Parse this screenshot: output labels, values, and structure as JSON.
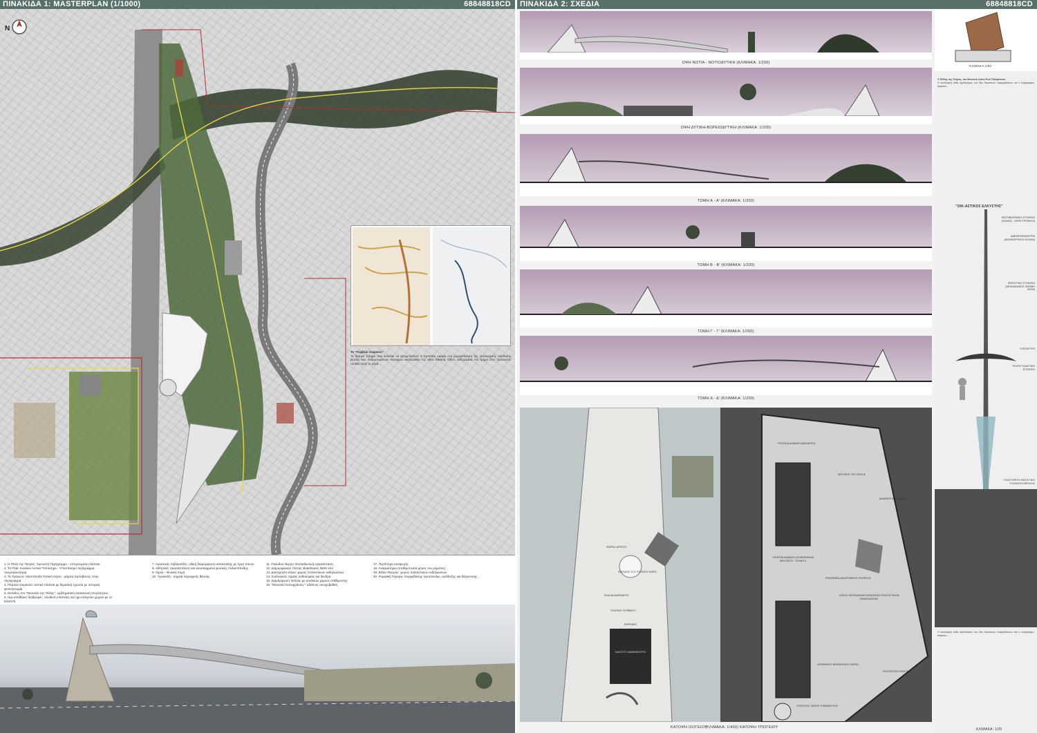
{
  "sheet1": {
    "title": "ΠΙΝΑΚΙΔΑ 1: MASTERPLAN (1/1000)",
    "code": "68848818CD",
    "north": "N",
    "desc_heading": "Το \"Περβόλι Ουρανού\"",
    "desc_text": "Το βασικό ζήτημα που καλείται να αντιμετωπίσει η πρόταση αφορά στη μορφοποίηση της λειτουργικής σύνδεσης μεταξύ των απομονωμένων περιοχών εκατέρωθεν της οδού Εθνικής Οδού, ενδεχόμενα στο τμήμα που πρόσκειται τοπικά προς το ρέμα...",
    "legend": [
      "1. Η Πύλη της Πετρας: Χρεωστή Περίγραμμο - υπογειωμένη πλατεία",
      "2. Το Πλάι: Κυκλικό Αστικό Τοπόσημο - Υποστάσιμο περίγραμμο, Ανεμογεννήτρια",
      "3. Το Τρίγωνο: Ηλιοτόποδο Τοπικό κτίριο - ράμπα πρόσβασης στην περίγραμμα",
      "4. Πλατεία Ουρανού: αστική πλατεία με θεματική έχουσα με ιστορική φυσιογνωμία",
      "5. Είσοδος στο \"Μουσείο της Πόλης\": εμβληματική κατασκευή στεγάστρου",
      "6. Ημι-υπαίθριες διαδρομές: σύνδεση πλατείας και ημι-υπόγειου χώρου με το ΕΘΙΑΓΕ",
      "7. Αγαστικός Λαβύρινθος: οδική διαμόρφωση καταστάλης με έργα πόνου",
      "8. Αθλητικές εγκαταστάσεις και ανασκαμμένα φυσικής πολυεπίπεδης",
      "9. Λίμνη - Φυσική πηγή",
      "10. Υγειοειδή - σημεία περιοχικής θέασης",
      "11. Πολυδύο Νερού: Εκπαιδευτική εγκατάσταση",
      "12. Διαμορφώσεις πίστας skateboard, BMX κλπ",
      "13. Διατηρητέο κτίριο: χώρος πολιτιστικών εκδηλώσεων",
      "14. Συλλογικός τομέας ανθοκομίας και δενδρα",
      "15. Διαμόρφωση πισίνας με κυκλικών χώρων στάθμευσης",
      "16. \"Μουσικό Κατοφράκτες\": υδάτινες ανοιχοβαθείς",
      "17. Περίπτερο αναψυχής",
      "18. Αναψυκτήριο (σταθμοί κατά μήκος του ρέματος)",
      "19. Βιλλα Φιγγιών: χώρος πολιτιστικών εκδηλώσεων",
      "20. Ρωμαϊκή Γέφυρα: περιμέβασης προστασίας, ανάδειξης και διέρευνσης"
    ]
  },
  "sheet2": {
    "title": "ΠΙΝΑΚΙΔΑ 2: ΣΧΕΔΙΑ",
    "code": "68848818CD",
    "elevations": [
      "ΟΨΗ ΝΟΤΙΑ - ΝΟΤΙΟΔΥΤΙΚΗ (ΚΛΙΜΑΚΑ: 1/200)",
      "ΟΨΗ ΔΥΤΙΚΗ-ΒΟΡΕΙΟΔΥΤΙΚΗ (ΚΛΙΜΑΚΑ: 1/200)",
      "ΤΟΜΗ Α - Α' (ΚΛΙΜΑΚΑ: 1/200)",
      "ΤΟΜΗ Β - Β' (ΚΛΙΜΑΚΑ: 1/200)",
      "ΤΟΜΗ Γ - Γ' (ΚΛΙΜΑΚΑ: 1/200)",
      "ΤΟΜΗ Δ - Δ' (ΚΛΙΜΑΚΑ: 1/200)"
    ],
    "detail_scale": "ΚΛΙΜΑΚΑ 1/50",
    "detail_title": "\"ΟΙΚ-ΑΣΤΙΚΟΣ ΕΛΚΥΣΤΗΣ\"",
    "detail_labels": [
      "ΦΩΤΟΒΟΛΤΑΙΚΟ ΣΤΟΙΧΕΙΟ (ΚΩΝΟΣ - ΠΕΡΙΣΤΡΟΦΙΚΟ)",
      "ΑΝΕΜΟΓΕΝΝΗΤΡΙΑ (ΚΑΤΑΚΟΡΥΦΟΥ ΑΞΟΝΑ)",
      "ΦΩΤΙΣΤΙΚΟ ΣΤΟΙΧΕΙΟ (ΜΗΧΑΝΙΣΜΟΣ ΟΝΟΜΗ ΚΕΡΑ)",
      "ΣΤΕΓΑΣΤΡΟ",
      "ΠΛΑΤΗ ΠΛΑΣΤΙΚΟ ΣΤΟΙΧΕΙΟ",
      "ΥΠΟΣΤΗΡΙΞΗ ΦΩΤΙΣΤΙΚΟ ΣΥΛΛΕΚΤΗ ΒΡΟΧΗΣ"
    ],
    "detail_text_heading": "Ο Πύλης της Πετρας, του Μουσείο Οικού Ρωϊ/ Πολιμάτινοι",
    "detail_text": "Η οικολογική κάθε σχεδιασμός των δύο θεματικών παρεμβάσεων και ο περίγραφος σαρκικό...",
    "plan_left_labels": [
      "ΠΛΑΤΕΙΑ \"ΟΥΡΑΝΟΥ\"",
      "ΚΕΡΚΙΔΕΣ",
      "ΚΑΛΥΠΤΟ ΑΜΦΙΘΕΑΤΡΟ",
      "ΕΙΣΟΔΟΣ ΣΤΟ ΥΠΟΓΕΙΟ ΧΩΡΟ",
      "ΣΚΑΛΙΑ ΜΑΡΜΑΡΟΥ",
      "ΦΩΡΟΣ ΑΡΕΤΟΥ"
    ],
    "plan_right_labels": [
      "ΥΠΟΓΕΙΑ ΔΙΑΒΑΣΗ (ΒΑΣΑΝΤΗ)",
      "ΜΟΥΣΕΙΟ ΤΗΣ ΠΟΛΗΣ",
      "ΔΙΑΔΡΑΣΤΙΚΑ ΜΑΚΕΤΑ",
      "ΥΠΟΓΕΙΑ ΔΙΑΒΑΣΗ (ΕΠΙΚΟΙΝΩΝΙΑ ΜΟΥΣΕΙΟΥ - ΕΘΙΑΓΕ)",
      "ΕΠΙΦΑΝΕΙΑ ΔΙΑΧΡΟΝΙΚΗΣ ΕΚΘΕΣΗΣ",
      "ΧΩΡΟΣ ΠΕΡΙΟΔΙΚΩΝ ΕΚΘΕΣΕΩΝ ΠΟΛΙΤΙΣΤΙΚΩΝ ΕΚΔΗΛΩΣΕΩΝ",
      "ΑΠΟΘΗΚΕΣ ΒΟΗΘΗΤΙΚΟΙ ΧΩΡΟΙ",
      "ΠΟΛΙΤΙΣΤΙΚΟ ΚΕΝΤΡΟ",
      "ΥΠΟΓΕΙΟΣ ΧΩΡΟΣ ΣΤΑΘΜΕΥΣΗΣ"
    ],
    "plan_left_title": "ΚΑΤΟΨΗ ΙΣΟΓΕΙΟΥ",
    "plan_left_scale": "(ΚΛΙΜΑΚΑ: 1/400)",
    "plan_right_title": "ΚΑΤΟΨΗ ΥΠΟΓΕΙΟΥ",
    "detail_bottom_scale": "ΚΛΙΜΑΚΑ: 1/25"
  }
}
